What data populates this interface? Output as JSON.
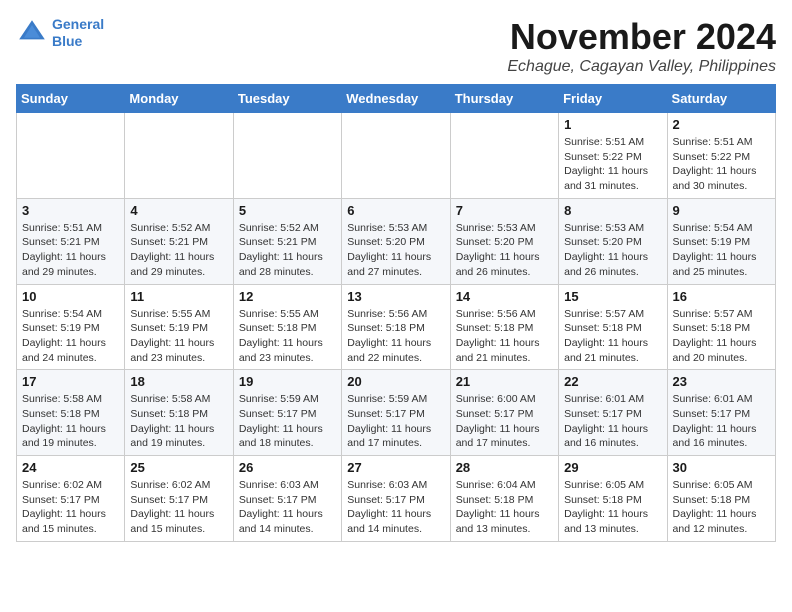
{
  "logo": {
    "line1": "General",
    "line2": "Blue"
  },
  "title": "November 2024",
  "location": "Echague, Cagayan Valley, Philippines",
  "weekdays": [
    "Sunday",
    "Monday",
    "Tuesday",
    "Wednesday",
    "Thursday",
    "Friday",
    "Saturday"
  ],
  "weeks": [
    [
      {
        "day": "",
        "info": ""
      },
      {
        "day": "",
        "info": ""
      },
      {
        "day": "",
        "info": ""
      },
      {
        "day": "",
        "info": ""
      },
      {
        "day": "",
        "info": ""
      },
      {
        "day": "1",
        "info": "Sunrise: 5:51 AM\nSunset: 5:22 PM\nDaylight: 11 hours and 31 minutes."
      },
      {
        "day": "2",
        "info": "Sunrise: 5:51 AM\nSunset: 5:22 PM\nDaylight: 11 hours and 30 minutes."
      }
    ],
    [
      {
        "day": "3",
        "info": "Sunrise: 5:51 AM\nSunset: 5:21 PM\nDaylight: 11 hours and 29 minutes."
      },
      {
        "day": "4",
        "info": "Sunrise: 5:52 AM\nSunset: 5:21 PM\nDaylight: 11 hours and 29 minutes."
      },
      {
        "day": "5",
        "info": "Sunrise: 5:52 AM\nSunset: 5:21 PM\nDaylight: 11 hours and 28 minutes."
      },
      {
        "day": "6",
        "info": "Sunrise: 5:53 AM\nSunset: 5:20 PM\nDaylight: 11 hours and 27 minutes."
      },
      {
        "day": "7",
        "info": "Sunrise: 5:53 AM\nSunset: 5:20 PM\nDaylight: 11 hours and 26 minutes."
      },
      {
        "day": "8",
        "info": "Sunrise: 5:53 AM\nSunset: 5:20 PM\nDaylight: 11 hours and 26 minutes."
      },
      {
        "day": "9",
        "info": "Sunrise: 5:54 AM\nSunset: 5:19 PM\nDaylight: 11 hours and 25 minutes."
      }
    ],
    [
      {
        "day": "10",
        "info": "Sunrise: 5:54 AM\nSunset: 5:19 PM\nDaylight: 11 hours and 24 minutes."
      },
      {
        "day": "11",
        "info": "Sunrise: 5:55 AM\nSunset: 5:19 PM\nDaylight: 11 hours and 23 minutes."
      },
      {
        "day": "12",
        "info": "Sunrise: 5:55 AM\nSunset: 5:18 PM\nDaylight: 11 hours and 23 minutes."
      },
      {
        "day": "13",
        "info": "Sunrise: 5:56 AM\nSunset: 5:18 PM\nDaylight: 11 hours and 22 minutes."
      },
      {
        "day": "14",
        "info": "Sunrise: 5:56 AM\nSunset: 5:18 PM\nDaylight: 11 hours and 21 minutes."
      },
      {
        "day": "15",
        "info": "Sunrise: 5:57 AM\nSunset: 5:18 PM\nDaylight: 11 hours and 21 minutes."
      },
      {
        "day": "16",
        "info": "Sunrise: 5:57 AM\nSunset: 5:18 PM\nDaylight: 11 hours and 20 minutes."
      }
    ],
    [
      {
        "day": "17",
        "info": "Sunrise: 5:58 AM\nSunset: 5:18 PM\nDaylight: 11 hours and 19 minutes."
      },
      {
        "day": "18",
        "info": "Sunrise: 5:58 AM\nSunset: 5:18 PM\nDaylight: 11 hours and 19 minutes."
      },
      {
        "day": "19",
        "info": "Sunrise: 5:59 AM\nSunset: 5:17 PM\nDaylight: 11 hours and 18 minutes."
      },
      {
        "day": "20",
        "info": "Sunrise: 5:59 AM\nSunset: 5:17 PM\nDaylight: 11 hours and 17 minutes."
      },
      {
        "day": "21",
        "info": "Sunrise: 6:00 AM\nSunset: 5:17 PM\nDaylight: 11 hours and 17 minutes."
      },
      {
        "day": "22",
        "info": "Sunrise: 6:01 AM\nSunset: 5:17 PM\nDaylight: 11 hours and 16 minutes."
      },
      {
        "day": "23",
        "info": "Sunrise: 6:01 AM\nSunset: 5:17 PM\nDaylight: 11 hours and 16 minutes."
      }
    ],
    [
      {
        "day": "24",
        "info": "Sunrise: 6:02 AM\nSunset: 5:17 PM\nDaylight: 11 hours and 15 minutes."
      },
      {
        "day": "25",
        "info": "Sunrise: 6:02 AM\nSunset: 5:17 PM\nDaylight: 11 hours and 15 minutes."
      },
      {
        "day": "26",
        "info": "Sunrise: 6:03 AM\nSunset: 5:17 PM\nDaylight: 11 hours and 14 minutes."
      },
      {
        "day": "27",
        "info": "Sunrise: 6:03 AM\nSunset: 5:17 PM\nDaylight: 11 hours and 14 minutes."
      },
      {
        "day": "28",
        "info": "Sunrise: 6:04 AM\nSunset: 5:18 PM\nDaylight: 11 hours and 13 minutes."
      },
      {
        "day": "29",
        "info": "Sunrise: 6:05 AM\nSunset: 5:18 PM\nDaylight: 11 hours and 13 minutes."
      },
      {
        "day": "30",
        "info": "Sunrise: 6:05 AM\nSunset: 5:18 PM\nDaylight: 11 hours and 12 minutes."
      }
    ]
  ]
}
